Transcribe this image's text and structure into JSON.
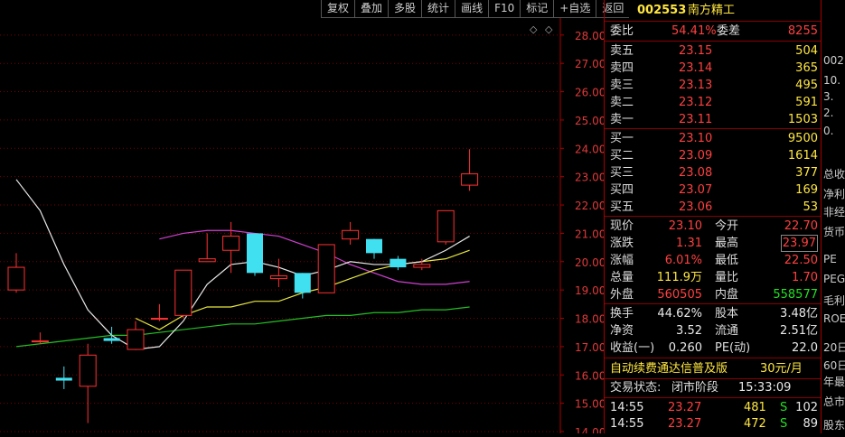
{
  "toolbar": {
    "items": [
      "复权",
      "叠加",
      "多股",
      "统计",
      "画线",
      "F10",
      "标记",
      "+自选",
      "返回"
    ]
  },
  "chart_data": {
    "type": "candlestick",
    "ylim": [
      14.0,
      28.6
    ],
    "y_ticks": [
      "28.00",
      "27.00",
      "26.00",
      "25.00",
      "24.00",
      "23.00",
      "22.00",
      "21.00",
      "20.00",
      "19.00",
      "18.00",
      "17.00",
      "16.00",
      "15.00",
      "14.00"
    ],
    "candles": [
      {
        "o": 19.0,
        "c": 19.8,
        "h": 20.3,
        "l": 18.9
      },
      {
        "o": 17.2,
        "c": 17.2,
        "h": 17.5,
        "l": 17.1
      },
      {
        "o": 15.9,
        "c": 15.8,
        "h": 16.3,
        "l": 15.5
      },
      {
        "o": 15.6,
        "c": 16.7,
        "h": 17.1,
        "l": 14.3
      },
      {
        "o": 17.3,
        "c": 17.2,
        "h": 17.7,
        "l": 17.1
      },
      {
        "o": 16.9,
        "c": 17.6,
        "h": 17.9,
        "l": 16.9
      },
      {
        "o": 18.0,
        "c": 18.0,
        "h": 18.5,
        "l": 17.9
      },
      {
        "o": 18.1,
        "c": 19.7,
        "h": 19.7,
        "l": 18.0
      },
      {
        "o": 20.0,
        "c": 20.1,
        "h": 21.0,
        "l": 20.0
      },
      {
        "o": 20.4,
        "c": 20.9,
        "h": 21.4,
        "l": 19.6
      },
      {
        "o": 21.0,
        "c": 19.6,
        "h": 21.0,
        "l": 19.5
      },
      {
        "o": 19.4,
        "c": 19.5,
        "h": 20.1,
        "l": 19.1
      },
      {
        "o": 19.6,
        "c": 18.9,
        "h": 19.6,
        "l": 18.7
      },
      {
        "o": 18.9,
        "c": 20.6,
        "h": 20.6,
        "l": 18.9
      },
      {
        "o": 20.8,
        "c": 21.1,
        "h": 21.4,
        "l": 20.6
      },
      {
        "o": 20.8,
        "c": 20.3,
        "h": 20.8,
        "l": 20.1
      },
      {
        "o": 20.1,
        "c": 19.8,
        "h": 20.2,
        "l": 19.7
      },
      {
        "o": 19.8,
        "c": 19.9,
        "h": 20.1,
        "l": 19.7
      },
      {
        "o": 20.7,
        "c": 21.8,
        "h": 21.8,
        "l": 20.6
      },
      {
        "o": 22.7,
        "c": 23.1,
        "h": 23.97,
        "l": 22.5
      }
    ],
    "ma_white": [
      22.9,
      21.8,
      19.9,
      18.3,
      17.4,
      16.9,
      17.0,
      17.9,
      19.2,
      19.9,
      20.0,
      19.8,
      19.5,
      19.7,
      20.0,
      19.9,
      19.9,
      20.0,
      20.4,
      20.9
    ],
    "ma_yellow": [
      null,
      null,
      null,
      null,
      null,
      18.0,
      17.6,
      18.1,
      18.4,
      18.4,
      18.6,
      18.6,
      18.9,
      19.1,
      19.4,
      19.7,
      19.9,
      20.0,
      20.1,
      20.4
    ],
    "ma_magenta": [
      null,
      null,
      null,
      null,
      null,
      null,
      20.8,
      21.0,
      21.1,
      21.1,
      21.0,
      20.9,
      20.6,
      20.3,
      19.9,
      19.6,
      19.3,
      19.2,
      19.2,
      19.3
    ],
    "ma_green": [
      17.0,
      17.1,
      17.2,
      17.3,
      17.4,
      17.4,
      17.5,
      17.6,
      17.7,
      17.8,
      17.8,
      17.9,
      18.0,
      18.1,
      18.1,
      18.2,
      18.2,
      18.3,
      18.3,
      18.4
    ]
  },
  "quote": {
    "code": "002553",
    "name": "南方精工",
    "weibi_label": "委比",
    "weibi_value": "54.41%",
    "weicha_label": "委差",
    "weicha_value": "8255",
    "asks": [
      {
        "label": "卖五",
        "price": "23.15",
        "vol": "504"
      },
      {
        "label": "卖四",
        "price": "23.14",
        "vol": "365"
      },
      {
        "label": "卖三",
        "price": "23.13",
        "vol": "495"
      },
      {
        "label": "卖二",
        "price": "23.12",
        "vol": "591"
      },
      {
        "label": "卖一",
        "price": "23.11",
        "vol": "1503"
      }
    ],
    "bids": [
      {
        "label": "买一",
        "price": "23.10",
        "vol": "9500"
      },
      {
        "label": "买二",
        "price": "23.09",
        "vol": "1614"
      },
      {
        "label": "买三",
        "price": "23.08",
        "vol": "377"
      },
      {
        "label": "买四",
        "price": "23.07",
        "vol": "169"
      },
      {
        "label": "买五",
        "price": "23.06",
        "vol": "53"
      }
    ],
    "stats": [
      {
        "l1": "现价",
        "v1": "23.10",
        "l2": "今开",
        "v2": "22.70",
        "c1": "red",
        "c2": "red"
      },
      {
        "l1": "涨跌",
        "v1": "1.31",
        "l2": "最高",
        "v2": "23.97",
        "c1": "red",
        "c2": "red"
      },
      {
        "l1": "涨幅",
        "v1": "6.01%",
        "l2": "最低",
        "v2": "22.50",
        "c1": "red",
        "c2": "red"
      },
      {
        "l1": "总量",
        "v1": "111.9万",
        "l2": "量比",
        "v2": "1.70",
        "c1": "yellow",
        "c2": "red"
      },
      {
        "l1": "外盘",
        "v1": "560505",
        "l2": "内盘",
        "v2": "558577",
        "c1": "red",
        "c2": "green"
      }
    ],
    "stats2": [
      {
        "l1": "换手",
        "v1": "44.62%",
        "l2": "股本",
        "v2": "3.48亿"
      },
      {
        "l1": "净资",
        "v1": "3.52",
        "l2": "流通",
        "v2": "2.51亿"
      },
      {
        "l1": "收益(一)",
        "v1": "0.260",
        "l2": "PE(动)",
        "v2": "22.0"
      }
    ],
    "promo": "自动续费通达信普及版",
    "promo_price": "30元/月",
    "status_label": "交易状态:",
    "status_value": "闭市阶段",
    "status_time": "15:33:09",
    "ticks": [
      {
        "time": "14:55",
        "price": "23.27",
        "vol": "481",
        "side": "S",
        "n": "102"
      },
      {
        "time": "14:55",
        "price": "23.27",
        "vol": "472",
        "side": "S",
        "n": "89"
      }
    ]
  },
  "right_strip": {
    "items": [
      "002",
      "10.",
      "3.",
      "2.",
      "0.",
      "总收",
      "净利",
      "非经",
      "货币",
      "PE",
      "PEG",
      "毛利",
      "ROE",
      "20日",
      "60日",
      "年最",
      "总市",
      "股东"
    ]
  }
}
